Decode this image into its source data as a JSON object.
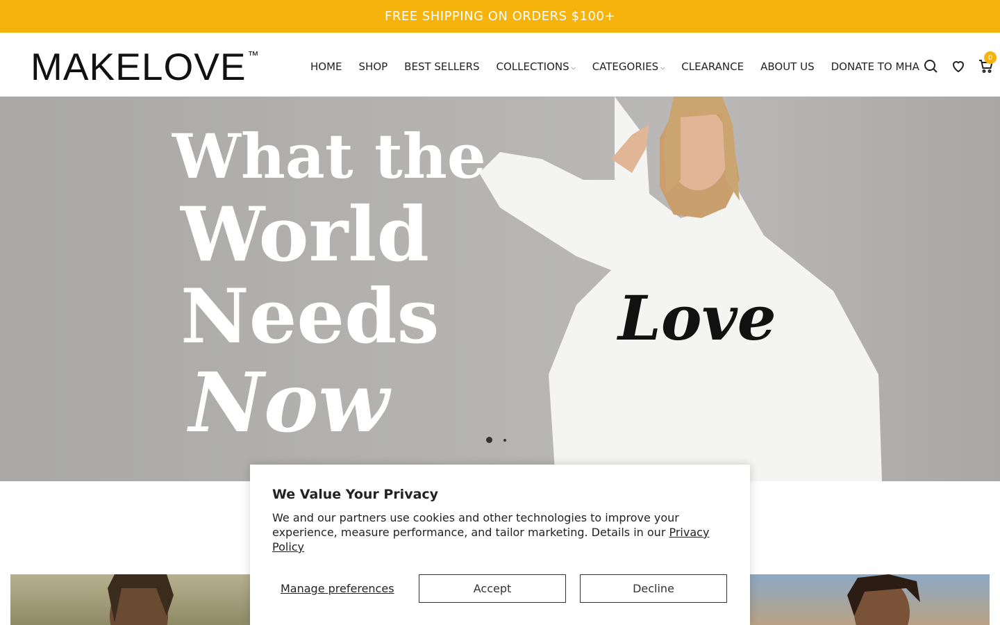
{
  "announcement": {
    "text": "FREE SHIPPING ON ORDERS $100+"
  },
  "header": {
    "logo_text": "MAKELOVE",
    "logo_tm": "™",
    "nav": [
      {
        "label": "HOME"
      },
      {
        "label": "SHOP"
      },
      {
        "label": "BEST SELLERS"
      },
      {
        "label": "COLLECTIONS",
        "has_dropdown": true
      },
      {
        "label": "CATEGORIES",
        "has_dropdown": true
      },
      {
        "label": "CLEARANCE"
      },
      {
        "label": "ABOUT US"
      },
      {
        "label": "DONATE TO MHA"
      }
    ],
    "icons": [
      "search-icon",
      "heart-icon",
      "cart-icon"
    ],
    "cart_count": "0"
  },
  "hero": {
    "headline_lines": [
      "What the",
      "World",
      "Needs",
      "Now"
    ],
    "sweatshirt_text": "Love",
    "slides": 2,
    "active_slide": 1
  },
  "cookie_banner": {
    "title": "We Value Your Privacy",
    "body": "We and our partners use cookies and other technologies to improve your experience, measure performance, and tailor marketing. Details in our ",
    "link": "Privacy Policy",
    "manage_label": "Manage preferences",
    "accept_label": "Accept",
    "decline_label": "Decline"
  },
  "colors": {
    "accent": "#f5b30b",
    "text": "#222222"
  }
}
